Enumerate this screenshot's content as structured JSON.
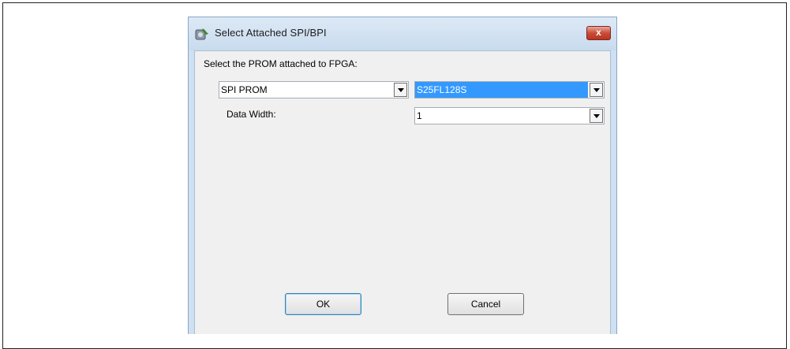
{
  "dialog": {
    "title": "Select Attached SPI/BPI",
    "close_label": "x",
    "prompt": "Select the PROM attached to FPGA:",
    "prom_type": {
      "value": "SPI PROM"
    },
    "prom_part": {
      "value": "S25FL128S"
    },
    "data_width": {
      "label": "Data Width:",
      "value": "1"
    },
    "ok_label": "OK",
    "cancel_label": "Cancel"
  },
  "colors": {
    "selection": "#3399ff",
    "close_button": "#cc4b38"
  }
}
